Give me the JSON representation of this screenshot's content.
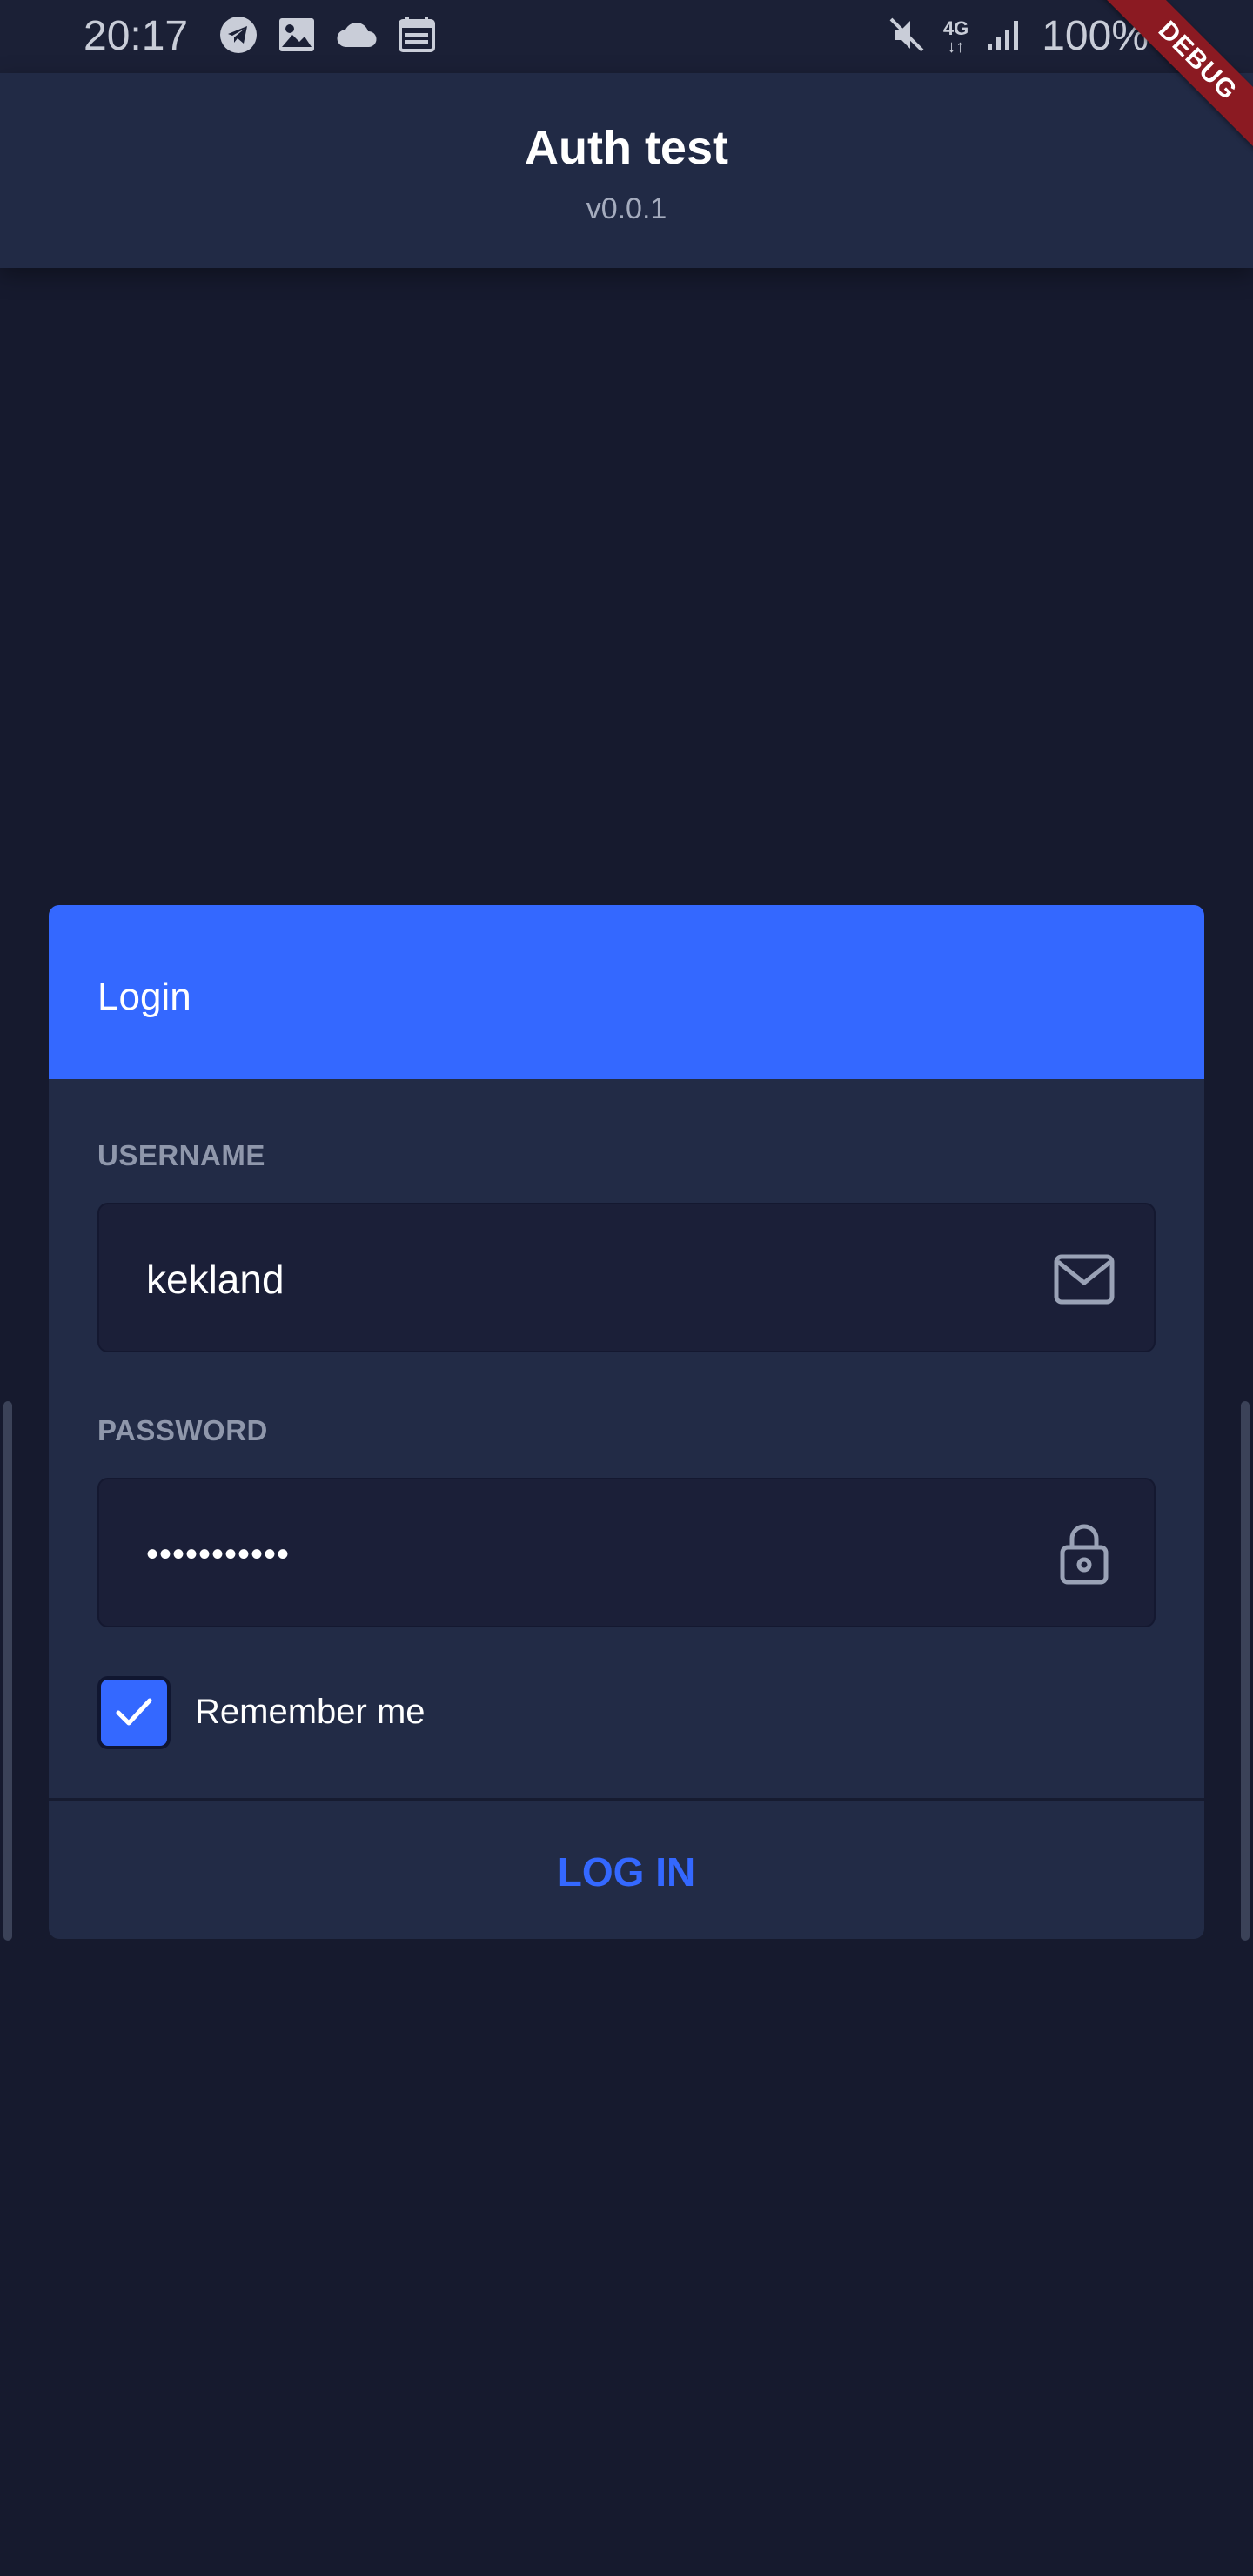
{
  "status_bar": {
    "time": "20:17",
    "network": "4G",
    "battery": "100%",
    "left_icons": [
      "telegram-icon",
      "gallery-icon",
      "cloud-icon",
      "calendar-icon"
    ],
    "right_icons": [
      "mute-icon",
      "network-4g-icon",
      "signal-icon",
      "battery-icon"
    ]
  },
  "debug_banner": "DEBUG",
  "app_bar": {
    "title": "Auth test",
    "version": "v0.0.1"
  },
  "login_card": {
    "title": "Login",
    "username": {
      "label": "USERNAME",
      "value": "kekland",
      "icon": "mail-icon"
    },
    "password": {
      "label": "PASSWORD",
      "value": "•••••••••••",
      "icon": "lock-icon"
    },
    "remember_me": {
      "label": "Remember me",
      "checked": true
    },
    "submit_label": "LOG IN"
  },
  "colors": {
    "background": "#161a2e",
    "app_bar": "#212a45",
    "card": "#222b46",
    "accent": "#3468ff",
    "input_bg": "#1b1f38",
    "label": "#8f97ab",
    "debug": "#8b1a22"
  }
}
